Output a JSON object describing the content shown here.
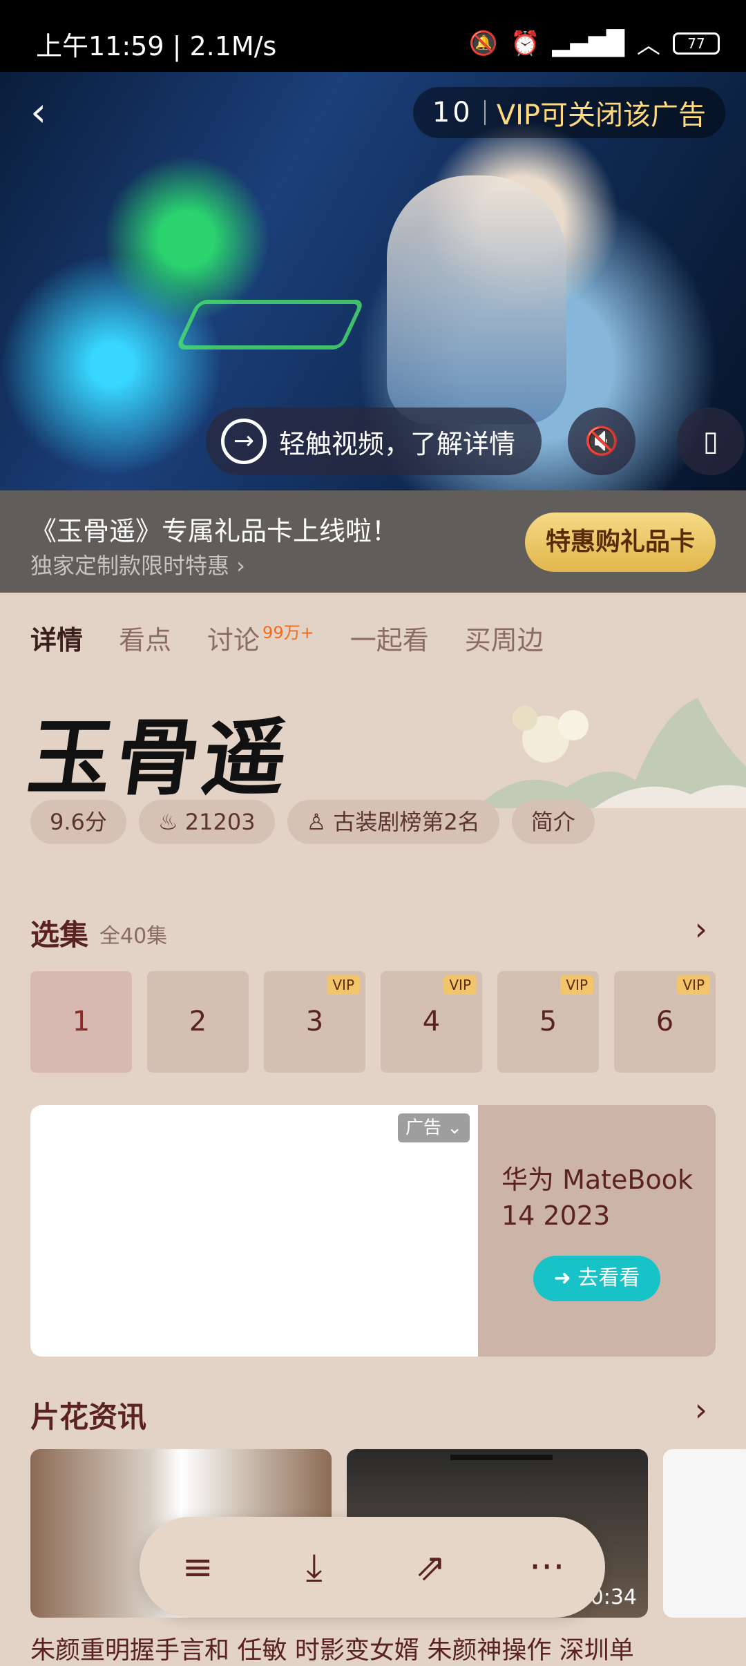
{
  "status": {
    "time": "上午11:59 | 2.1M/s",
    "battery": "77"
  },
  "video": {
    "ad_countdown": "10",
    "ad_close_text": "VIP可关闭该广告",
    "touch_text": "轻触视频，了解详情"
  },
  "promo": {
    "title": "《玉骨遥》专属礼品卡上线啦！",
    "subtitle": "独家定制款限时特惠 ›",
    "button": "特惠购礼品卡"
  },
  "tabs": [
    {
      "label": "详情"
    },
    {
      "label": "看点"
    },
    {
      "label": "讨论",
      "badge": "99万+"
    },
    {
      "label": "一起看"
    },
    {
      "label": "买周边"
    }
  ],
  "show": {
    "title_logo": "玉骨遥",
    "chips": [
      "9.6分",
      "21203",
      "古装剧榜第2名",
      "简介"
    ]
  },
  "episodes": {
    "title": "选集",
    "count": "全40集",
    "vip_badge": "VIP",
    "items": [
      "1",
      "2",
      "3",
      "4",
      "5",
      "6"
    ]
  },
  "ad": {
    "tag": "广告",
    "product": "华为 MateBook 14 2023",
    "button": "去看看"
  },
  "clips": {
    "title": "片花资讯",
    "duration": "0:34",
    "item_titles": "朱颜重明握手言和   任敏  时影变女婿   朱颜神操作   深圳单"
  }
}
